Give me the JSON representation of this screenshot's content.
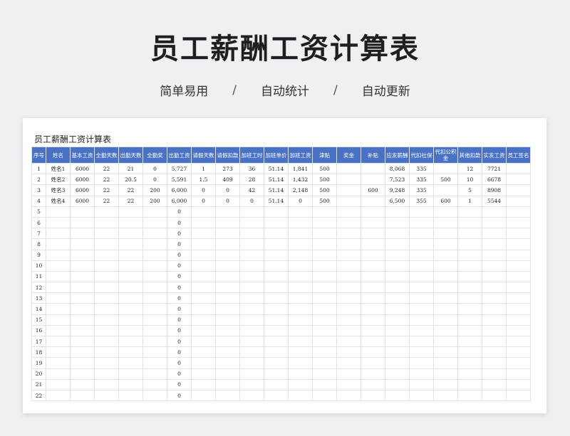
{
  "hero": {
    "title": "员工薪酬工资计算表",
    "features": [
      "简单易用",
      "自动统计",
      "自动更新"
    ],
    "separator": "/"
  },
  "sheet": {
    "title": "员工薪酬工资计算表",
    "header_bg": "#4a72c4",
    "columns": [
      "序号",
      "姓名",
      "基本工资",
      "全勤天数",
      "出勤天数",
      "全勤奖",
      "出勤工资",
      "请假天数",
      "请假扣款",
      "加班工时",
      "加班单价",
      "加班工资",
      "津贴",
      "奖金",
      "补贴",
      "应发薪酬",
      "代扣社保",
      "代扣公积金",
      "其他扣款",
      "实发工资",
      "员工签名"
    ],
    "rows": [
      [
        "1",
        "姓名1",
        "6000",
        "22",
        "21",
        "0",
        "5,727",
        "1",
        "273",
        "36",
        "51.14",
        "1,841",
        "500",
        "",
        "",
        "8,068",
        "335",
        "",
        "12",
        "7721",
        ""
      ],
      [
        "2",
        "姓名2",
        "6000",
        "22",
        "20.5",
        "0",
        "5,591",
        "1.5",
        "409",
        "28",
        "51.14",
        "1,432",
        "500",
        "",
        "",
        "7,523",
        "335",
        "500",
        "10",
        "6678",
        ""
      ],
      [
        "3",
        "姓名3",
        "6000",
        "22",
        "22",
        "200",
        "6,000",
        "0",
        "0",
        "42",
        "51.14",
        "2,148",
        "500",
        "",
        "600",
        "9,248",
        "335",
        "",
        "5",
        "8908",
        ""
      ],
      [
        "4",
        "姓名4",
        "6000",
        "22",
        "22",
        "200",
        "6,000",
        "0",
        "0",
        "0",
        "51.14",
        "0",
        "500",
        "",
        "",
        "6,500",
        "355",
        "600",
        "1",
        "5544",
        ""
      ],
      [
        "5",
        "",
        "",
        "",
        "",
        "",
        "0",
        "",
        "",
        "",
        "",
        "",
        "",
        "",
        "",
        "",
        "",
        "",
        "",
        "",
        ""
      ],
      [
        "6",
        "",
        "",
        "",
        "",
        "",
        "0",
        "",
        "",
        "",
        "",
        "",
        "",
        "",
        "",
        "",
        "",
        "",
        "",
        "",
        ""
      ],
      [
        "7",
        "",
        "",
        "",
        "",
        "",
        "0",
        "",
        "",
        "",
        "",
        "",
        "",
        "",
        "",
        "",
        "",
        "",
        "",
        "",
        ""
      ],
      [
        "8",
        "",
        "",
        "",
        "",
        "",
        "0",
        "",
        "",
        "",
        "",
        "",
        "",
        "",
        "",
        "",
        "",
        "",
        "",
        "",
        ""
      ],
      [
        "9",
        "",
        "",
        "",
        "",
        "",
        "0",
        "",
        "",
        "",
        "",
        "",
        "",
        "",
        "",
        "",
        "",
        "",
        "",
        "",
        ""
      ],
      [
        "10",
        "",
        "",
        "",
        "",
        "",
        "0",
        "",
        "",
        "",
        "",
        "",
        "",
        "",
        "",
        "",
        "",
        "",
        "",
        "",
        ""
      ],
      [
        "11",
        "",
        "",
        "",
        "",
        "",
        "0",
        "",
        "",
        "",
        "",
        "",
        "",
        "",
        "",
        "",
        "",
        "",
        "",
        "",
        ""
      ],
      [
        "12",
        "",
        "",
        "",
        "",
        "",
        "0",
        "",
        "",
        "",
        "",
        "",
        "",
        "",
        "",
        "",
        "",
        "",
        "",
        "",
        ""
      ],
      [
        "13",
        "",
        "",
        "",
        "",
        "",
        "0",
        "",
        "",
        "",
        "",
        "",
        "",
        "",
        "",
        "",
        "",
        "",
        "",
        "",
        ""
      ],
      [
        "14",
        "",
        "",
        "",
        "",
        "",
        "0",
        "",
        "",
        "",
        "",
        "",
        "",
        "",
        "",
        "",
        "",
        "",
        "",
        "",
        ""
      ],
      [
        "15",
        "",
        "",
        "",
        "",
        "",
        "0",
        "",
        "",
        "",
        "",
        "",
        "",
        "",
        "",
        "",
        "",
        "",
        "",
        "",
        ""
      ],
      [
        "16",
        "",
        "",
        "",
        "",
        "",
        "0",
        "",
        "",
        "",
        "",
        "",
        "",
        "",
        "",
        "",
        "",
        "",
        "",
        "",
        ""
      ],
      [
        "17",
        "",
        "",
        "",
        "",
        "",
        "0",
        "",
        "",
        "",
        "",
        "",
        "",
        "",
        "",
        "",
        "",
        "",
        "",
        "",
        ""
      ],
      [
        "18",
        "",
        "",
        "",
        "",
        "",
        "0",
        "",
        "",
        "",
        "",
        "",
        "",
        "",
        "",
        "",
        "",
        "",
        "",
        "",
        ""
      ],
      [
        "19",
        "",
        "",
        "",
        "",
        "",
        "0",
        "",
        "",
        "",
        "",
        "",
        "",
        "",
        "",
        "",
        "",
        "",
        "",
        "",
        ""
      ],
      [
        "20",
        "",
        "",
        "",
        "",
        "",
        "0",
        "",
        "",
        "",
        "",
        "",
        "",
        "",
        "",
        "",
        "",
        "",
        "",
        "",
        ""
      ],
      [
        "21",
        "",
        "",
        "",
        "",
        "",
        "0",
        "",
        "",
        "",
        "",
        "",
        "",
        "",
        "",
        "",
        "",
        "",
        "",
        "",
        ""
      ],
      [
        "22",
        "",
        "",
        "",
        "",
        "",
        "0",
        "",
        "",
        "",
        "",
        "",
        "",
        "",
        "",
        "",
        "",
        "",
        "",
        "",
        ""
      ]
    ]
  }
}
